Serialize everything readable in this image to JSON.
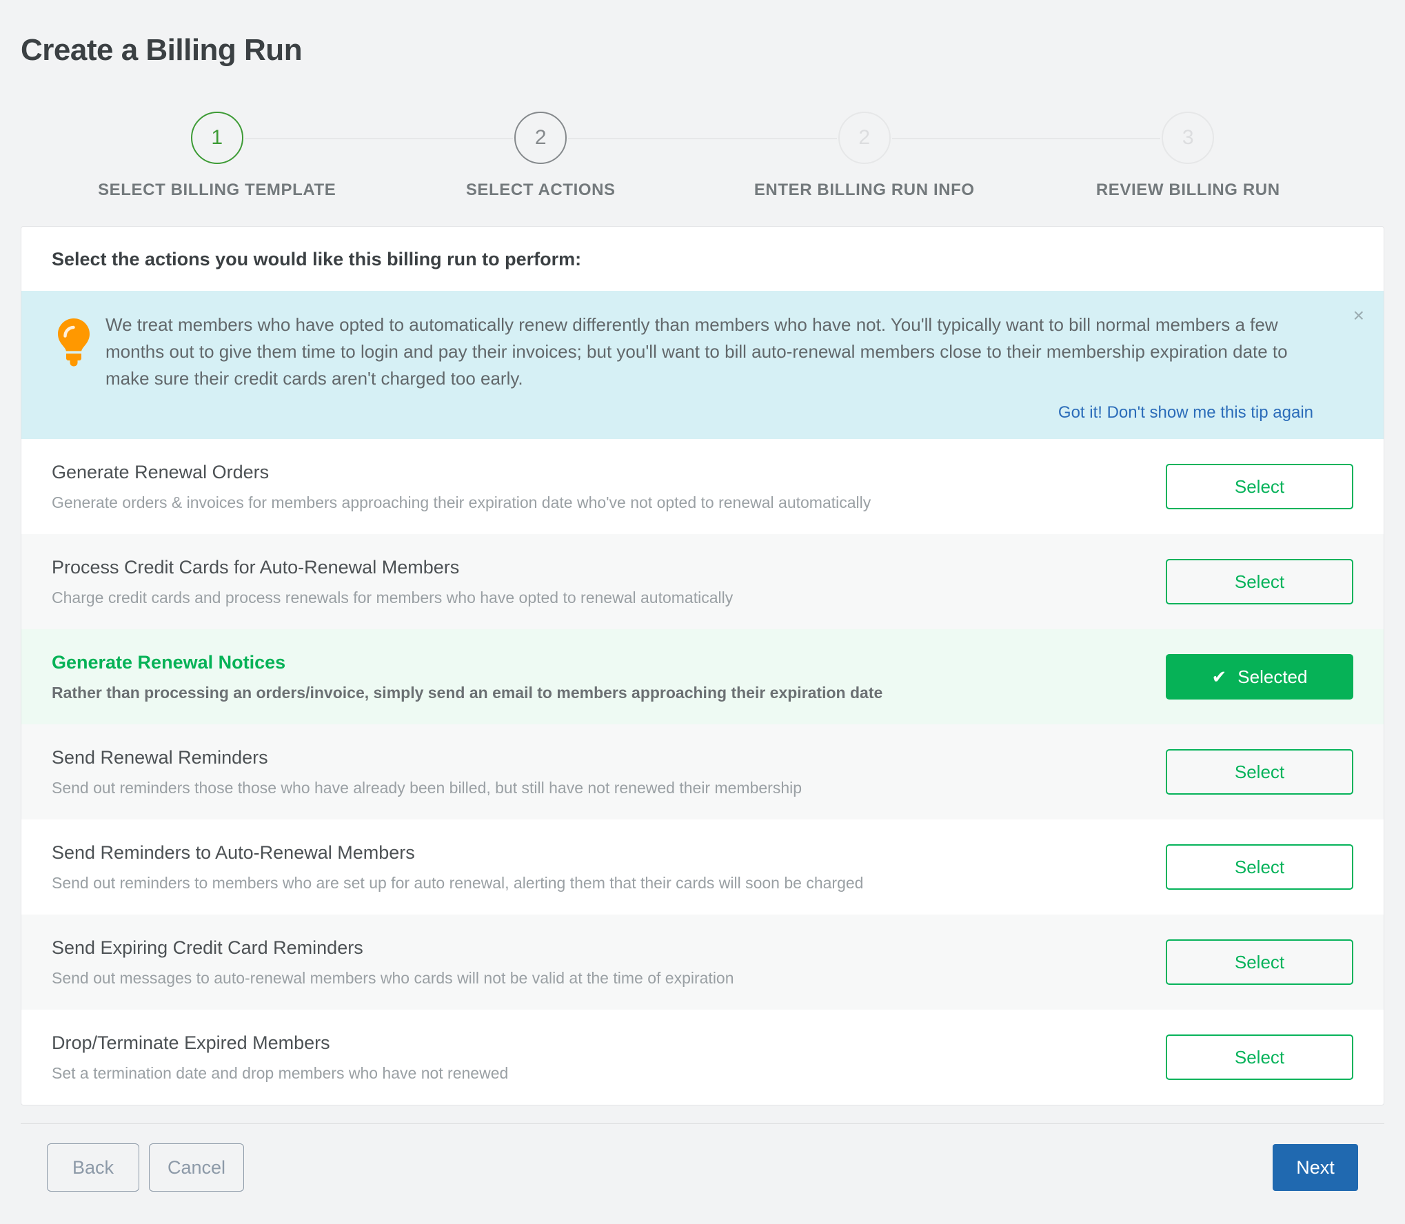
{
  "page_title": "Create a Billing Run",
  "colors": {
    "accent_green": "#06b257",
    "step_done_green": "#3d9b35",
    "tip_background": "#d6f0f5",
    "tip_link_blue": "#2b6cb9",
    "primary_blue": "#2069b0",
    "bulb_orange": "#ff9800",
    "selected_row_background": "#eefaf3"
  },
  "stepper": {
    "steps": [
      {
        "number": "1",
        "label": "Select Billing Template",
        "state": "done"
      },
      {
        "number": "2",
        "label": "Select Actions",
        "state": "active"
      },
      {
        "number": "2",
        "label": "Enter Billing Run Info",
        "state": "future"
      },
      {
        "number": "3",
        "label": "Review Billing Run",
        "state": "future"
      }
    ]
  },
  "card": {
    "header": "Select the actions you would like this billing run to perform:"
  },
  "tip": {
    "icon": "lightbulb-icon",
    "text": "We treat members who have opted to automatically renew differently than members who have not. You'll typically want to bill normal members a few months out to give them time to login and pay their invoices; but you'll want to bill auto-renewal members close to their membership expiration date to make sure their credit cards aren't charged too early.",
    "dismiss_link": "Got it! Don't show me this tip again",
    "close_icon": "×"
  },
  "button_labels": {
    "select": "Select",
    "selected": "Selected",
    "check_icon": "✔"
  },
  "actions": [
    {
      "title": "Generate Renewal Orders",
      "description": "Generate orders & invoices for members approaching their expiration date who've not opted to renewal automatically",
      "selected": false,
      "button_label": "Select"
    },
    {
      "title": "Process Credit Cards for Auto-Renewal Members",
      "description": "Charge credit cards and process renewals for members who have opted to renewal automatically",
      "selected": false,
      "button_label": "Select"
    },
    {
      "title": "Generate Renewal Notices",
      "description": "Rather than processing an orders/invoice, simply send an email to members approaching their expiration date",
      "selected": true,
      "button_label": "Selected"
    },
    {
      "title": "Send Renewal Reminders",
      "description": "Send out reminders those those who have already been billed, but still have not renewed their membership",
      "selected": false,
      "button_label": "Select"
    },
    {
      "title": "Send Reminders to Auto-Renewal Members",
      "description": "Send out reminders to members who are set up for auto renewal, alerting them that their cards will soon be charged",
      "selected": false,
      "button_label": "Select"
    },
    {
      "title": "Send Expiring Credit Card Reminders",
      "description": "Send out messages to auto-renewal members who cards will not be valid at the time of expiration",
      "selected": false,
      "button_label": "Select"
    },
    {
      "title": "Drop/Terminate Expired Members",
      "description": "Set a termination date and drop members who have not renewed",
      "selected": false,
      "button_label": "Select"
    }
  ],
  "footer": {
    "back_label": "Back",
    "cancel_label": "Cancel",
    "next_label": "Next"
  }
}
